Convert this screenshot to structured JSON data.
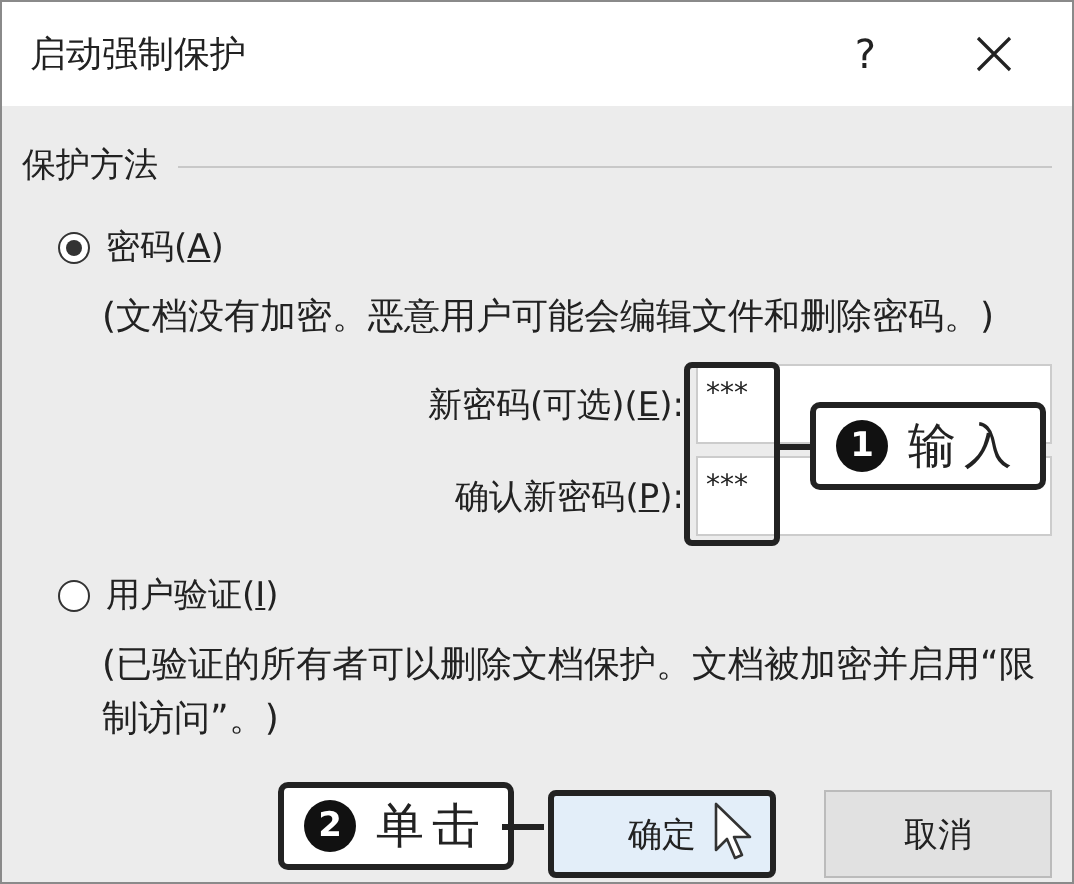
{
  "window": {
    "title": "启动强制保护",
    "help": "?"
  },
  "section": {
    "title": "保护方法"
  },
  "options": [
    {
      "label_before": "密码(",
      "key": "A",
      "label_after": ")",
      "selected": true,
      "description": "(文档没有加密。恶意用户可能会编辑文件和删除密码。)",
      "fields": [
        {
          "label_before": "新密码(可选)(",
          "key": "E",
          "label_after": "):",
          "value": "***"
        },
        {
          "label_before": "确认新密码(",
          "key": "P",
          "label_after": "):",
          "value": "***"
        }
      ]
    },
    {
      "label_before": "用户验证(",
      "key": "I",
      "label_after": ")",
      "selected": false,
      "description": "(已验证的所有者可以删除文档保护。文档被加密并启用“限制访问”。)"
    }
  ],
  "buttons": [
    {
      "label": "确定",
      "default": true
    },
    {
      "label": "取消",
      "default": false
    }
  ],
  "callouts": [
    {
      "number": "1",
      "text": "输入"
    },
    {
      "number": "2",
      "text": "单击"
    }
  ]
}
